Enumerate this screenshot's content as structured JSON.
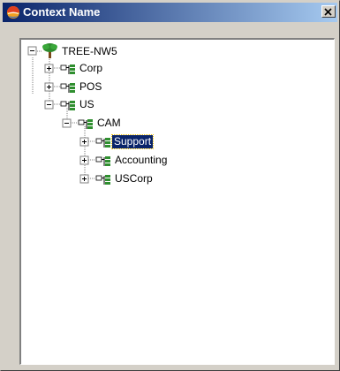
{
  "window": {
    "title": "Context Name",
    "title_icon": "globe-icon",
    "close_icon": "close-icon"
  },
  "tree": {
    "root": {
      "label": "TREE-NW5",
      "icon": "tree-icon",
      "expanded": true
    },
    "nodes": [
      {
        "label": "Corp",
        "icon": "org-unit-icon",
        "expanded": false,
        "selected": false
      },
      {
        "label": "POS",
        "icon": "org-unit-icon",
        "expanded": false,
        "selected": false
      },
      {
        "label": "US",
        "icon": "org-unit-icon",
        "expanded": true,
        "selected": false
      },
      {
        "label": "CAM",
        "icon": "org-unit-icon",
        "expanded": true,
        "selected": false
      },
      {
        "label": "Support",
        "icon": "org-unit-icon",
        "expanded": false,
        "selected": true
      },
      {
        "label": "Accounting",
        "icon": "org-unit-icon",
        "expanded": false,
        "selected": false
      },
      {
        "label": "USCorp",
        "icon": "org-unit-icon",
        "expanded": false,
        "selected": false
      }
    ]
  },
  "colors": {
    "titlebar_start": "#0a246a",
    "titlebar_end": "#a6caf0",
    "selection": "#0a246a",
    "tree_icon_green": "#2e8b2e",
    "org_icon_green": "#2f8f2f"
  }
}
